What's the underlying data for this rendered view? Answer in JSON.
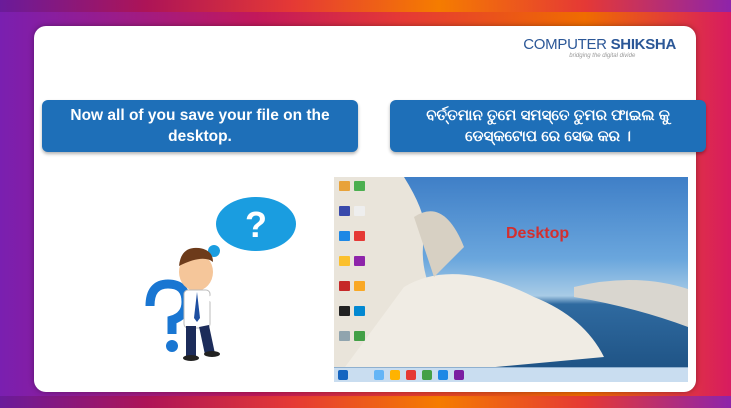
{
  "logo": {
    "brand_left": "COMPUTER",
    "brand_right": "SHIKSHA",
    "tagline": "bridging the digital divide"
  },
  "instruction_english": "Now all of you save your file on the desktop.",
  "instruction_odia": "ବର୍ତ୍ତମାନ ତୁମେ ସମସ୍ତେ ତୁମର ଫାଇଲ କୁ ଡେସ୍କଟୋପ ରେ ସେଭ କର ।",
  "desktop_label": "Desktop",
  "question_mark": "?",
  "colors": {
    "bubble": "#1e6fb8",
    "label": "#d32f2f",
    "brand": "#2b5797"
  }
}
